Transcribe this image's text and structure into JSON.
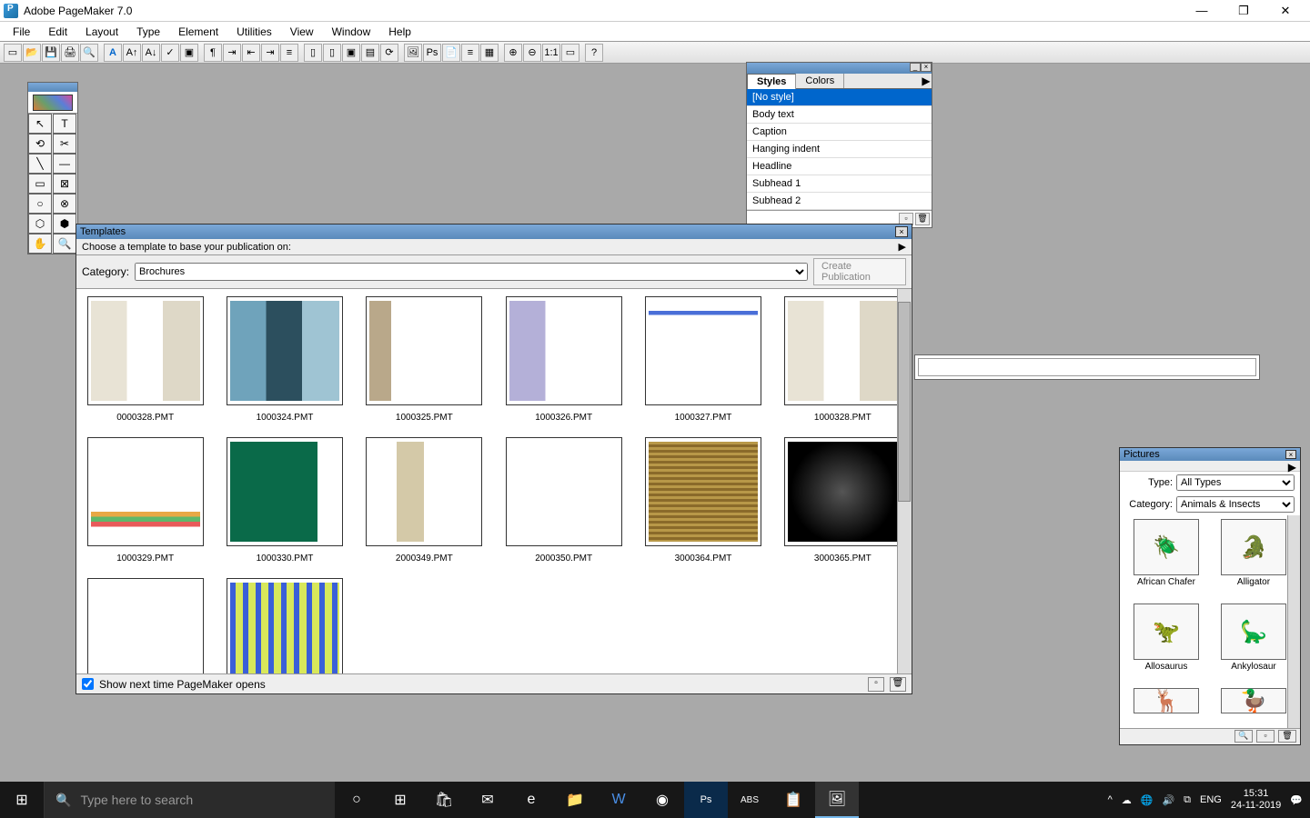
{
  "app": {
    "title": "Adobe PageMaker 7.0"
  },
  "window_controls": {
    "minimize": "—",
    "maximize": "❐",
    "close": "✕"
  },
  "menubar": [
    "File",
    "Edit",
    "Layout",
    "Type",
    "Element",
    "Utilities",
    "View",
    "Window",
    "Help"
  ],
  "styles_panel": {
    "tabs": [
      "Styles",
      "Colors"
    ],
    "items": [
      "[No style]",
      "Body text",
      "Caption",
      "Hanging indent",
      "Headline",
      "Subhead 1",
      "Subhead 2"
    ]
  },
  "templates": {
    "title": "Templates",
    "prompt": "Choose a template to base your publication on:",
    "category_label": "Category:",
    "category_value": "Brochures",
    "create_label": "Create Publication",
    "footer_checkbox": "Show next time PageMaker opens",
    "items": [
      {
        "name": "0000328.PMT",
        "cls": "tv1"
      },
      {
        "name": "1000324.PMT",
        "cls": "tv2"
      },
      {
        "name": "1000325.PMT",
        "cls": "tv3"
      },
      {
        "name": "1000326.PMT",
        "cls": "tv4"
      },
      {
        "name": "1000327.PMT",
        "cls": "tv5"
      },
      {
        "name": "1000328.PMT",
        "cls": "tv6"
      },
      {
        "name": "1000329.PMT",
        "cls": "tv7"
      },
      {
        "name": "1000330.PMT",
        "cls": "tv8"
      },
      {
        "name": "2000349.PMT",
        "cls": "tv9"
      },
      {
        "name": "2000350.PMT",
        "cls": "tv13"
      },
      {
        "name": "3000364.PMT",
        "cls": "tv10"
      },
      {
        "name": "3000365.PMT",
        "cls": "tv11"
      },
      {
        "name": "",
        "cls": "tv13"
      },
      {
        "name": "",
        "cls": "tv12"
      }
    ]
  },
  "pictures": {
    "title": "Pictures",
    "type_label": "Type:",
    "type_value": "All Types",
    "category_label": "Category:",
    "category_value": "Animals & Insects",
    "items": [
      {
        "name": "African Chafer",
        "glyph": "🪲"
      },
      {
        "name": "Alligator",
        "glyph": "🐊"
      },
      {
        "name": "Allosaurus",
        "glyph": "🦖"
      },
      {
        "name": "Ankylosaur",
        "glyph": "🦕"
      }
    ]
  },
  "taskbar": {
    "search_placeholder": "Type here to search",
    "lang": "ENG",
    "time": "15:31",
    "date": "24-11-2019"
  }
}
